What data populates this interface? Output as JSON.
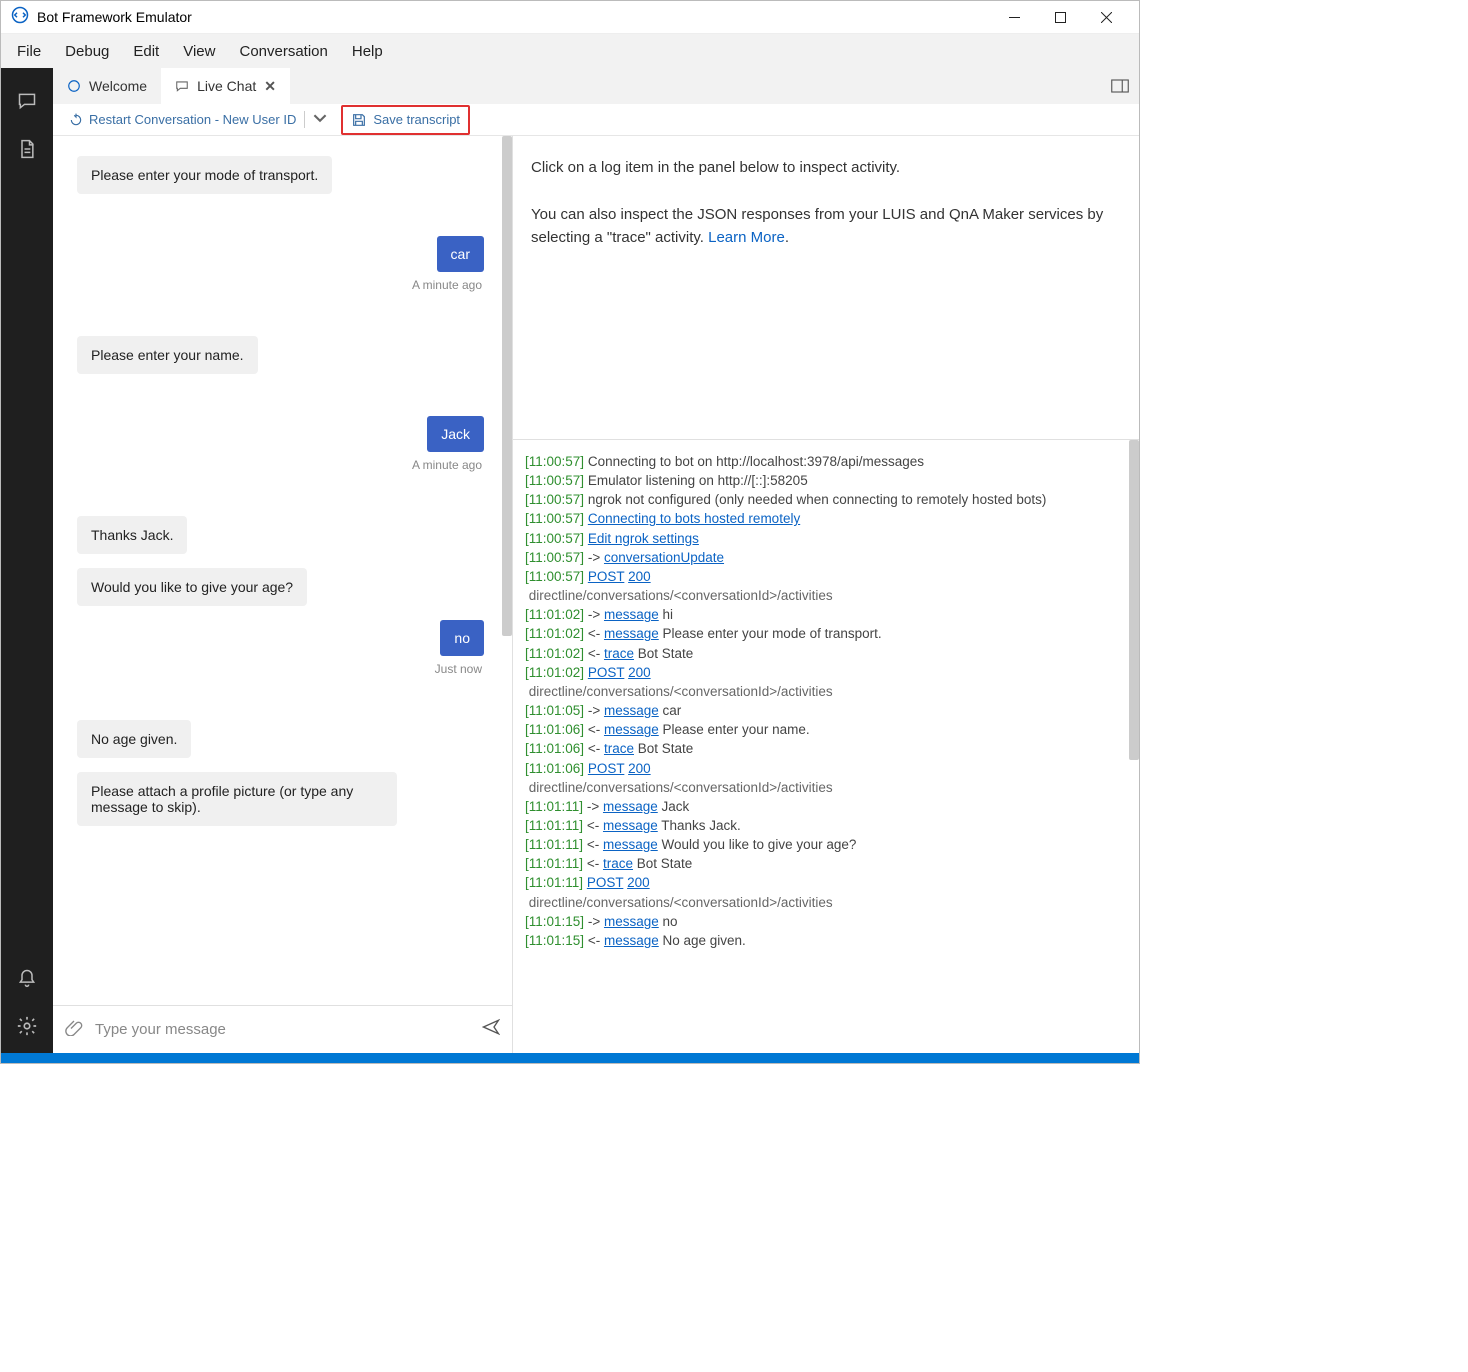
{
  "window": {
    "title": "Bot Framework Emulator"
  },
  "menu": {
    "items": [
      "File",
      "Debug",
      "Edit",
      "View",
      "Conversation",
      "Help"
    ]
  },
  "tabs": {
    "welcome": "Welcome",
    "livechat": "Live Chat"
  },
  "toolbar": {
    "restart": "Restart Conversation - New User ID",
    "save": "Save transcript"
  },
  "chat": {
    "messages": [
      {
        "role": "bot",
        "text": "Please enter your mode of transport."
      },
      {
        "role": "user",
        "text": "car",
        "ts": "A minute ago"
      },
      {
        "role": "bot",
        "text": "Please enter your name."
      },
      {
        "role": "user",
        "text": "Jack",
        "ts": "A minute ago"
      },
      {
        "role": "bot",
        "text": "Thanks Jack."
      },
      {
        "role": "bot",
        "text": "Would you like to give your age?"
      },
      {
        "role": "user",
        "text": "no",
        "ts": "Just now"
      },
      {
        "role": "bot",
        "text": "No age given."
      },
      {
        "role": "bot",
        "text": "Please attach a profile picture (or type any message to skip)."
      }
    ],
    "input_placeholder": "Type your message"
  },
  "inspector": {
    "line1": "Click on a log item in the panel below to inspect activity.",
    "line2a": "You can also inspect the JSON responses from your LUIS and QnA Maker services by selecting a \"trace\" activity. ",
    "learn_more": "Learn More"
  },
  "log": {
    "post": "POST",
    "code200": "200",
    "dl": " directline/conversations/<conversationId>/activities",
    "entries": [
      {
        "t": "[11:00:57]",
        "plain": " Connecting to bot on http://localhost:3978/api/messages"
      },
      {
        "t": "[11:00:57]",
        "plain": " Emulator listening on http://[::]:58205"
      },
      {
        "t": "[11:00:57]",
        "plain": " ngrok not configured (only needed when connecting to remotely hosted bots)"
      },
      {
        "t": "[11:00:57]",
        "link": "Connecting to bots hosted remotely"
      },
      {
        "t": "[11:00:57]",
        "link": "Edit ngrok settings"
      },
      {
        "t": "[11:00:57]",
        "arrow": "->",
        "link": "conversationUpdate"
      },
      {
        "t": "[11:00:57]",
        "post200": true
      },
      {
        "t": "[11:01:02]",
        "arrow": "->",
        "link": "message",
        "tail": "hi"
      },
      {
        "t": "[11:01:02]",
        "arrow": "<-",
        "link": "message",
        "tail": "Please enter your mode of transport."
      },
      {
        "t": "[11:01:02]",
        "arrow": "<-",
        "link": "trace",
        "tail": "Bot State"
      },
      {
        "t": "[11:01:02]",
        "post200": true
      },
      {
        "t": "[11:01:05]",
        "arrow": "->",
        "link": "message",
        "tail": "car"
      },
      {
        "t": "[11:01:06]",
        "arrow": "<-",
        "link": "message",
        "tail": "Please enter your name."
      },
      {
        "t": "[11:01:06]",
        "arrow": "<-",
        "link": "trace",
        "tail": "Bot State"
      },
      {
        "t": "[11:01:06]",
        "post200": true
      },
      {
        "t": "[11:01:11]",
        "arrow": "->",
        "link": "message",
        "tail": "Jack"
      },
      {
        "t": "[11:01:11]",
        "arrow": "<-",
        "link": "message",
        "tail": "Thanks Jack."
      },
      {
        "t": "[11:01:11]",
        "arrow": "<-",
        "link": "message",
        "tail": "Would you like to give your age?"
      },
      {
        "t": "[11:01:11]",
        "arrow": "<-",
        "link": "trace",
        "tail": "Bot State"
      },
      {
        "t": "[11:01:11]",
        "post200": true
      },
      {
        "t": "[11:01:15]",
        "arrow": "->",
        "link": "message",
        "tail": "no"
      },
      {
        "t": "[11:01:15]",
        "arrow": "<-",
        "link": "message",
        "tail": "No age given."
      }
    ]
  }
}
